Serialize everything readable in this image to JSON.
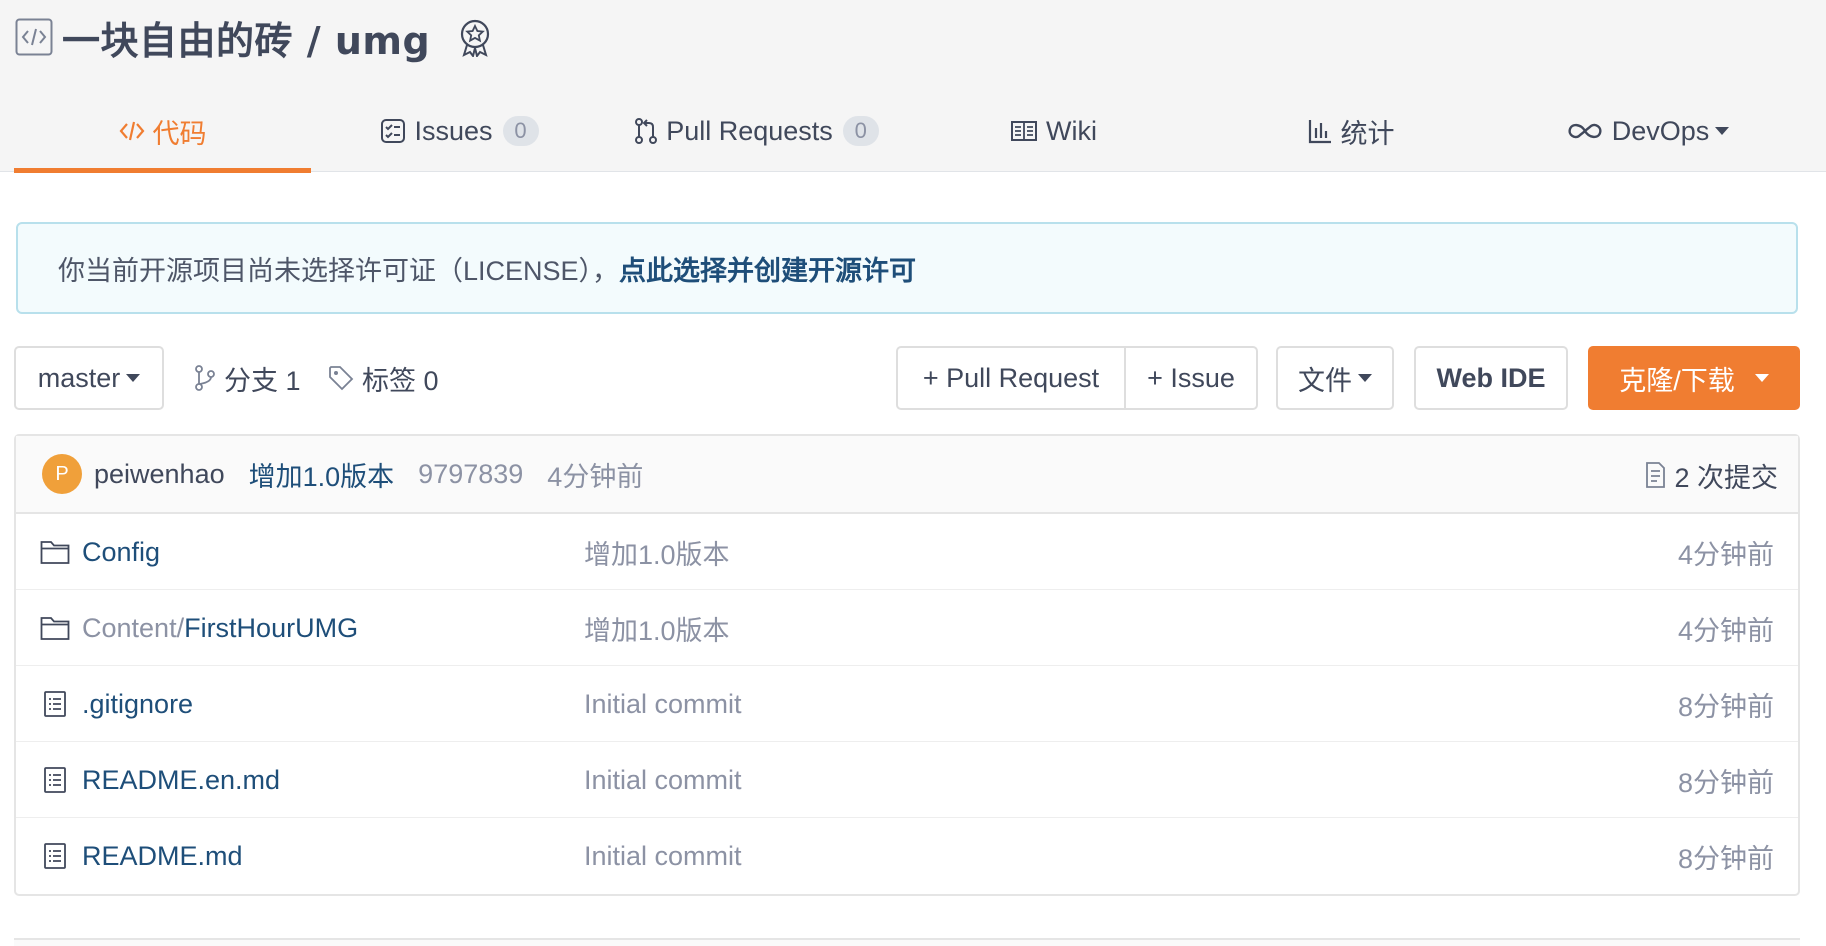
{
  "repo": {
    "title": "一块自由的砖 / umg",
    "type_icon": "code-repo-icon",
    "badge_icon": "award-badge-icon"
  },
  "tabs": [
    {
      "label": "代码",
      "icon": "code-icon",
      "active": true
    },
    {
      "label": "Issues",
      "icon": "issues-icon",
      "count": "0"
    },
    {
      "label": "Pull Requests",
      "icon": "pull-request-icon",
      "count": "0"
    },
    {
      "label": "Wiki",
      "icon": "book-icon"
    },
    {
      "label": "统计",
      "icon": "bar-chart-icon"
    },
    {
      "label": "DevOps",
      "icon": "infinity-icon",
      "dropdown": true
    }
  ],
  "license_notice": {
    "text": "你当前开源项目尚未选择许可证（LICENSE），",
    "link": "点此选择并创建开源许可"
  },
  "toolbar": {
    "branch": "master",
    "branches": "分支 1",
    "tags": "标签 0",
    "new_pr": "+ Pull Request",
    "new_issue": "+ Issue",
    "file": "文件",
    "web_ide": "Web IDE",
    "clone": "克隆/下载"
  },
  "commit": {
    "avatar_letter": "P",
    "author": "peiwenhao",
    "message": "增加1.0版本",
    "sha": "9797839",
    "time": "4分钟前",
    "count": "2 次提交"
  },
  "files": [
    {
      "type": "folder",
      "prefix": "",
      "name": "Config",
      "message": "增加1.0版本",
      "time": "4分钟前"
    },
    {
      "type": "folder",
      "prefix": "Content/",
      "name": "FirstHourUMG",
      "message": "增加1.0版本",
      "time": "4分钟前"
    },
    {
      "type": "file",
      "prefix": "",
      "name": ".gitignore",
      "message": "Initial commit",
      "time": "8分钟前"
    },
    {
      "type": "file",
      "prefix": "",
      "name": "README.en.md",
      "message": "Initial commit",
      "time": "8分钟前"
    },
    {
      "type": "file",
      "prefix": "",
      "name": "README.md",
      "message": "Initial commit",
      "time": "8分钟前"
    }
  ],
  "colors": {
    "accent": "#f07d31",
    "link": "#1e4e79",
    "muted": "#8c92a4",
    "text": "#40485b"
  }
}
